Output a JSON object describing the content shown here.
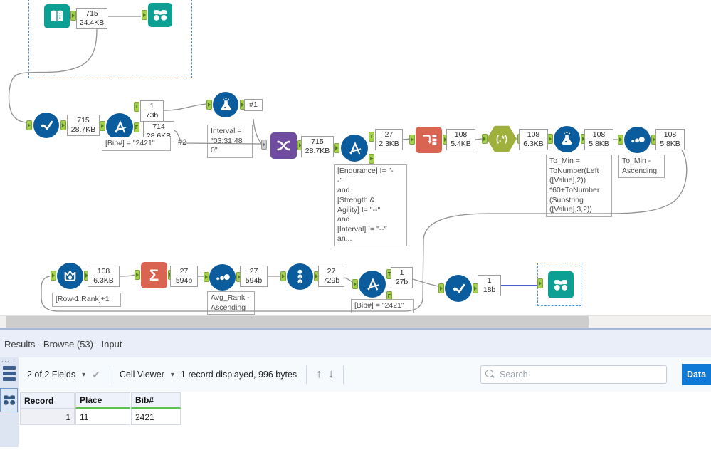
{
  "colors": {
    "tool_teal": "#0E9F94",
    "tool_blue": "#0B5C9D",
    "tool_orange": "#D96452",
    "tool_olive": "#9FB13C",
    "tool_purple": "#6F4C9F",
    "anchor_green": "#A6CF4E",
    "selected_wire": "#5560D0",
    "data_button_blue": "#0d7ad8",
    "table_green_underline": "#5cc04e"
  },
  "canvas": {
    "boxes": {
      "input_out": "715\n24.4KB",
      "select_out": "715\n28.7KB",
      "filter1_t": "1\n73b",
      "filter1_f": "714\n28.6KB",
      "formula1_out": "#1",
      "union_out": "715\n28.7KB",
      "filter2_t": "27\n2.3KB",
      "ttc_out": "108\n5.4KB",
      "regex_out": "108\n6.3KB",
      "formula2_out": "108\n5.8KB",
      "sort1_out": "108\n5.8KB",
      "multirow_out": "108\n6.3KB",
      "summarize_out": "27\n594b",
      "sort2_out": "27\n594b",
      "recordid_out": "27\n729b",
      "filter3_t": "1\n27b",
      "select2_out": "1\n18b"
    },
    "annotations": {
      "filter1": "[Bib#] = \"2421\"",
      "formula1": "Interval =\n\"03:31.48 0\"",
      "filter2": "[Endurance] != \"-\n-\"\nand\n[Strength &\nAgility] != \"--\"\nand\n[Interval] != \"--\"\nan...",
      "formula2": "To_Min =\nToNumber(Left\n([Value],2))\n*60+ToNumber\n(Substring\n([Value],3,2))",
      "sort1": "To_Min -\nAscending",
      "multirow": "[Row-1:Rank]+1",
      "sort2": "Avg_Rank -\nAscending",
      "filter3": "[Bib#] = \"2421\""
    },
    "labels": {
      "hash2": "#2",
      "regex": "(.*)",
      "sigma": "Σ",
      "t": "T",
      "f": "F"
    }
  },
  "panel": {
    "title": "Results - Browse (53) - Input",
    "toolbar": {
      "fields": "2 of 2 Fields",
      "cell_viewer": "Cell Viewer",
      "record_info": "1 record displayed, 996 bytes",
      "search_placeholder": "Search",
      "data_button": "Data"
    },
    "glyphs": {
      "dropdown": "▾",
      "up": "↑",
      "down": "↓",
      "check": "✔"
    },
    "table": {
      "columns": [
        "Record",
        "Place",
        "Bib#"
      ],
      "rows": [
        [
          "1",
          "11",
          "2421"
        ]
      ]
    }
  }
}
